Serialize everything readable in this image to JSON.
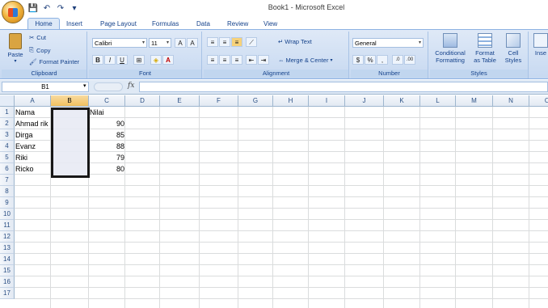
{
  "window": {
    "title": "Book1 - Microsoft Excel"
  },
  "quick_access": [
    "save-icon",
    "undo-icon",
    "redo-icon",
    "customize-icon"
  ],
  "tabs": [
    "Home",
    "Insert",
    "Page Layout",
    "Formulas",
    "Data",
    "Review",
    "View"
  ],
  "ribbon": {
    "clipboard": {
      "paste": "Paste",
      "cut": "Cut",
      "copy": "Copy",
      "format_painter": "Format Painter",
      "label": "Clipboard"
    },
    "font": {
      "name": "Calibri",
      "size": "11",
      "label": "Font"
    },
    "alignment": {
      "wrap": "Wrap Text",
      "merge": "Merge & Center",
      "label": "Alignment"
    },
    "number": {
      "format": "General",
      "label": "Number",
      "currency": "$",
      "percent": "%",
      "comma": ","
    },
    "styles": {
      "conditional_1": "Conditional",
      "conditional_2": "Formatting",
      "format_table_1": "Format",
      "format_table_2": "as Table",
      "cell_styles_1": "Cell",
      "cell_styles_2": "Styles",
      "label": "Styles"
    },
    "cells": {
      "insert": "Inse"
    }
  },
  "formula_bar": {
    "name_box": "B1",
    "fx": "fx",
    "content": ""
  },
  "columns": [
    "A",
    "B",
    "C",
    "D",
    "E",
    "F",
    "G",
    "H",
    "I",
    "J",
    "K",
    "L",
    "M",
    "N",
    "O"
  ],
  "rows": [
    "1",
    "2",
    "3",
    "4",
    "5",
    "6",
    "7",
    "8",
    "9",
    "10",
    "11",
    "12",
    "13",
    "14",
    "15",
    "16",
    "17"
  ],
  "cells": {
    "A1": "Nama",
    "C1": "Nilai",
    "A2": "Ahmad rik",
    "C2": "90",
    "A3": "Dirga",
    "C3": "85",
    "A4": "Evanz",
    "C4": "88",
    "A5": "Riki",
    "C5": "79",
    "A6": "Ricko",
    "C6": "80"
  },
  "colors": {
    "selection_border": "#000000",
    "selection_fill": "#e8ebf5",
    "ribbon": "#c7d9f1",
    "header_sel": "#f1c15f"
  }
}
